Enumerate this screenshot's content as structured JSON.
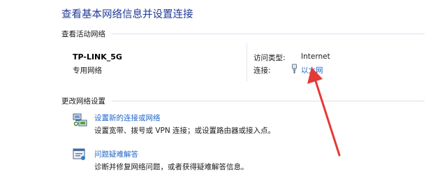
{
  "title": "查看基本网络信息并设置连接",
  "active_networks": {
    "label": "查看活动网络",
    "network": {
      "name": "TP-LINK_5G",
      "type": "专用网络",
      "access_type_label": "访问类型:",
      "access_type_value": "Internet",
      "connection_label": "连接:",
      "connection_value": "以太网"
    }
  },
  "change_settings": {
    "label": "更改网络设置",
    "items": [
      {
        "icon": "new-connection-icon",
        "title": "设置新的连接或网络",
        "description": "设置宽带、拨号或 VPN 连接；或设置路由器或接入点。"
      },
      {
        "icon": "troubleshoot-icon",
        "title": "问题疑难解答",
        "description": "诊断并修复网络问题，或者获得疑难解答信息。"
      }
    ]
  },
  "annotation": {
    "color": "#e53935"
  }
}
